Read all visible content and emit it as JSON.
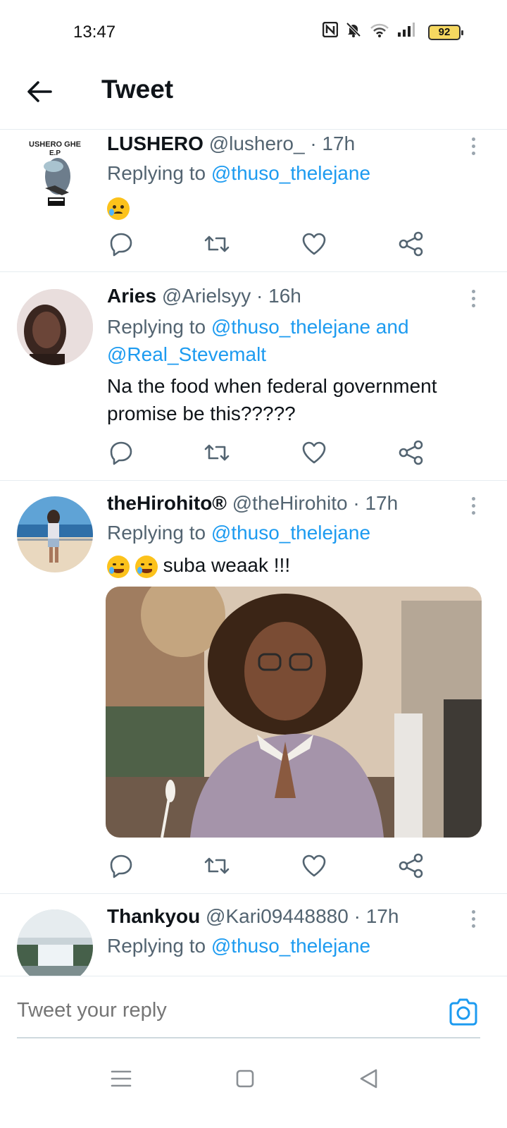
{
  "status_bar": {
    "time": "13:47",
    "battery": "92"
  },
  "header": {
    "title": "Tweet"
  },
  "tweets": [
    {
      "name": "LUSHERO",
      "handle": "@lushero_",
      "sep": "·",
      "time": "17h",
      "replying_prefix": "Replying to ",
      "mentions": "@thuso_thelejane",
      "text": "",
      "emoji": "crying-face",
      "avatar_text": "USHERO GHE E.P"
    },
    {
      "name": "Aries",
      "handle": "@Arielsyy",
      "sep": "·",
      "time": "16h",
      "replying_prefix": "Replying to ",
      "mentions": "@thuso_thelejane and @Real_Stevemalt",
      "text": "Na the food when federal government promise be this?????"
    },
    {
      "name": "theHirohito®",
      "handle": "@theHirohito",
      "sep": "·",
      "time": "17h",
      "replying_prefix": "Replying to ",
      "mentions": "@thuso_thelejane",
      "text": "suba weaak !!!",
      "emoji": "tears-of-joy"
    },
    {
      "name": "Thankyou",
      "handle": "@Kari09448880",
      "sep": "·",
      "time": "17h",
      "replying_prefix": "Replying to ",
      "mentions": "@thuso_thelejane"
    }
  ],
  "composer": {
    "placeholder": "Tweet your reply"
  },
  "colors": {
    "accent": "#1d9bf0",
    "text": "#0f1419",
    "secondary": "#536471"
  },
  "icons": [
    "back-arrow-icon",
    "nfc-icon",
    "bell-muted-icon",
    "wifi-icon",
    "signal-icon",
    "battery-icon",
    "reply-icon",
    "retweet-icon",
    "like-icon",
    "share-icon",
    "more-icon",
    "camera-icon",
    "menu-icon",
    "home-square-icon",
    "back-triangle-icon"
  ]
}
